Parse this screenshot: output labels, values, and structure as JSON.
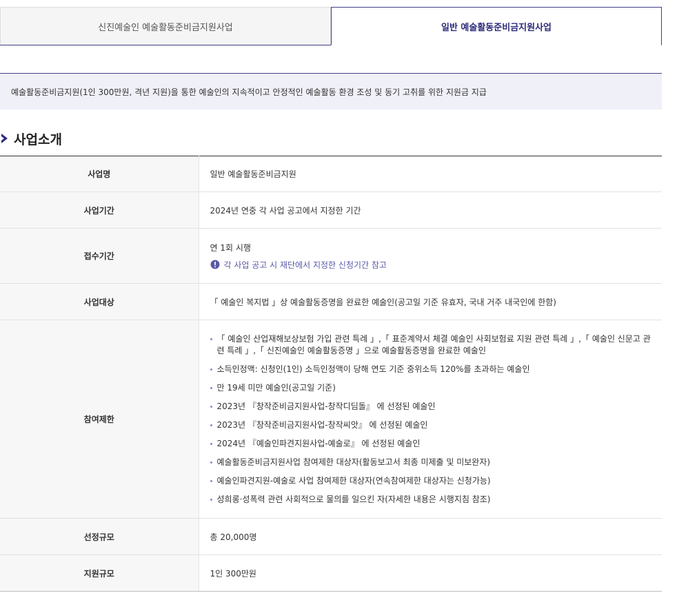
{
  "tabs": [
    {
      "label": "신진예술인 예술활동준비금지원사업",
      "active": false
    },
    {
      "label": "일반 예술활동준비금지원사업",
      "active": true
    }
  ],
  "intro": {
    "text": "예술활동준비금지원(1인 300만원, 격년 지원)을 통한 예술인의 지속적이고 안정적인 예술활동 환경 조성 및 동기 고취를 위한 지원금 지급"
  },
  "section": {
    "title": "사업소개"
  },
  "table": {
    "business_name": {
      "label": "사업명",
      "value": "일반 예술활동준비금지원"
    },
    "business_period": {
      "label": "사업기간",
      "value": "2024년 연중 각 사업 공고에서 지정한 기간"
    },
    "reception_period": {
      "label": "접수기간",
      "value": "연 1회 시행",
      "note": "각 사업 공고 시 재단에서 지정한 신청기간 참고"
    },
    "target": {
      "label": "사업대상",
      "value": "「 예술인 복지법 」상 예술활동증명을 완료한 예술인(공고일 기준 유효자, 국내 거주 내국인에 한함)"
    },
    "restrictions": {
      "label": "참여제한",
      "items": [
        "「 예술인 산업재해보상보험 가입 관련 특례 」,「 표준계약서 체결 예술인 사회보험료 지원 관련 특례 」,「 예술인 신문고 관련 특례 」,「 신진예술인 예술활동증명 」으로 예술활동증명을 완료한 예술인",
        "소득인정액: 신청인(1인) 소득인정액이 당해 연도 기준 중위소득 120%를 초과하는 예술인",
        "만 19세 미만 예술인(공고일 기준)",
        "2023년 『창작준비금지원사업-창작디딤돌』 에 선정된 예술인",
        "2023년 『창작준비금지원사업-창작씨앗』 에 선정된 예술인",
        "2024년 『예술인파견지원사업-예술로』 에 선정된 예술인",
        "예술활동준비금지원사업 참여제한 대상자(활동보고서 최종 미제출 및 미보완자)",
        "예술인파견지원-예술로 사업 참여제한 대상자(연속참여제한 대상자는 신청가능)",
        "성희롱·성폭력 관련 사회적으로 물의를 일으킨 자(자세한 내용은 시행지침 참조)"
      ]
    },
    "selection_scale": {
      "label": "선정규모",
      "value": "총 20,000명"
    },
    "support_scale": {
      "label": "지원규모",
      "value": "1인 300만원"
    }
  },
  "colors": {
    "accent": "#3f3d86",
    "note": "#5a58a8"
  }
}
